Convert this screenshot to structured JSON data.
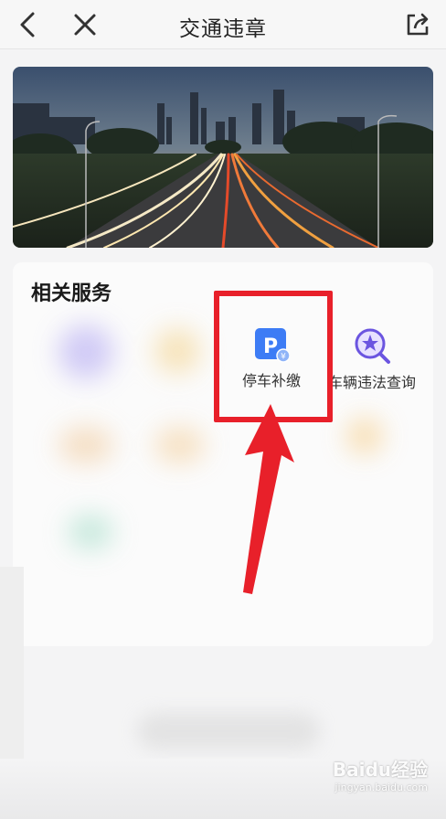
{
  "header": {
    "title": "交通违章",
    "back_icon": "chevron-left-icon",
    "close_icon": "close-icon",
    "share_icon": "share-icon"
  },
  "banner": {
    "description_icon": "city-highway-night-image"
  },
  "services": {
    "section_title": "相关服务",
    "items": [
      {
        "label": "停车补缴",
        "icon": "parking-payment-icon",
        "icon_text": "P",
        "color": "#3d7cf5"
      },
      {
        "label": "车辆违法查询",
        "icon": "violation-search-icon",
        "color": "#6b55e0"
      }
    ]
  },
  "watermark": {
    "brand": "Baidu经验",
    "url": "jingyan.baidu.com"
  },
  "colors": {
    "highlight": "#e8202a",
    "arrow": "#e8202a"
  }
}
